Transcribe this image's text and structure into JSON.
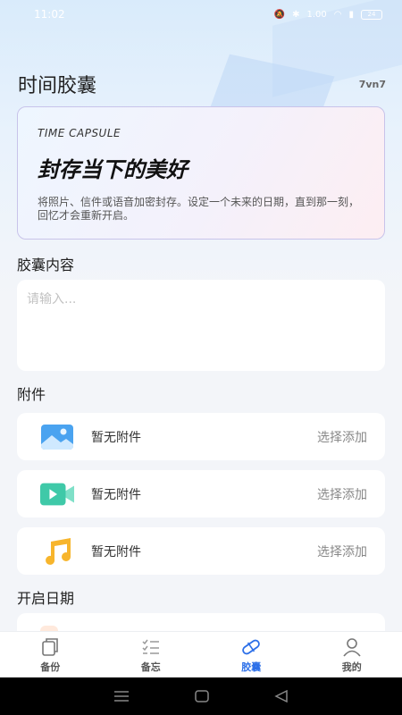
{
  "status": {
    "time": "11:02",
    "net": "1.00",
    "battery": "24"
  },
  "header": {
    "title": "时间胶囊",
    "user_code": "7vn7"
  },
  "intro": {
    "eyebrow": "TIME CAPSULE",
    "title": "封存当下的美好",
    "desc": "将照片、信件或语音加密封存。设定一个未来的日期，直到那一刻，回忆才会重新开启。"
  },
  "content": {
    "label": "胶囊内容",
    "placeholder": "请输入..."
  },
  "attachments": {
    "label": "附件",
    "items": [
      {
        "type": "image",
        "icon": "image-icon",
        "text": "暂无附件",
        "action": "选择添加"
      },
      {
        "type": "video",
        "icon": "video-icon",
        "text": "暂无附件",
        "action": "选择添加"
      },
      {
        "type": "audio",
        "icon": "music-icon",
        "text": "暂无附件",
        "action": "选择添加"
      }
    ]
  },
  "open_date": {
    "label": "开启日期"
  },
  "tabs": [
    {
      "label": "备份",
      "icon": "backup-icon",
      "active": false
    },
    {
      "label": "备忘",
      "icon": "memo-list-icon",
      "active": false
    },
    {
      "label": "胶囊",
      "icon": "capsule-icon",
      "active": true
    },
    {
      "label": "我的",
      "icon": "profile-icon",
      "active": false
    }
  ],
  "colors": {
    "accent": "#2c6fe8",
    "background": "#f3f5f9"
  }
}
